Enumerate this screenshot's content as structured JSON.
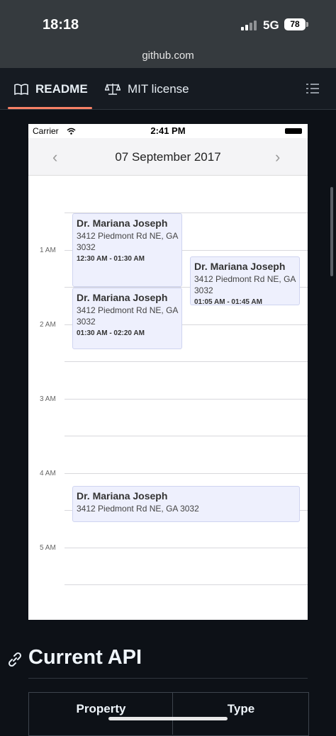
{
  "status": {
    "time": "18:18",
    "network": "5G",
    "battery": "78"
  },
  "browser": {
    "url": "github.com"
  },
  "tabs": [
    {
      "label": "README"
    },
    {
      "label": "MIT license"
    }
  ],
  "screenshot": {
    "carrier": "Carrier",
    "time": "2:41 PM",
    "date": "07 September 2017",
    "prev": "‹",
    "next": "›",
    "hours": [
      "1 AM",
      "2 AM",
      "3 AM",
      "4 AM",
      "5 AM"
    ],
    "events": [
      {
        "name": "Dr. Mariana Joseph",
        "address": "3412 Piedmont Rd NE, GA 3032",
        "time": "12:30 AM - 01:30 AM"
      },
      {
        "name": "Dr. Mariana Joseph",
        "address": "3412 Piedmont Rd NE, GA 3032",
        "time": "01:05 AM - 01:45 AM"
      },
      {
        "name": "Dr. Mariana Joseph",
        "address": "3412 Piedmont Rd NE, GA 3032",
        "time": "01:30 AM - 02:20 AM"
      },
      {
        "name": "Dr. Mariana Joseph",
        "address": "3412 Piedmont Rd NE, GA 3032"
      }
    ]
  },
  "section": {
    "title": "Current API"
  },
  "table": {
    "headers": [
      "Property",
      "Type"
    ]
  },
  "colors": {
    "accent": "#f78166",
    "event_bg": "#eef0fd"
  }
}
